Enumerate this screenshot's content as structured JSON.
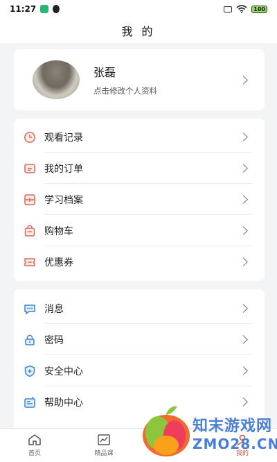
{
  "status": {
    "time": "11:27",
    "battery": "100"
  },
  "header": {
    "title": "我 的"
  },
  "profile": {
    "name": "张磊",
    "subtitle": "点击修改个人资料"
  },
  "menu_group_1": [
    {
      "label": "观看记录",
      "icon": "clock-icon"
    },
    {
      "label": "我的订单",
      "icon": "order-icon"
    },
    {
      "label": "学习档案",
      "icon": "archive-icon"
    },
    {
      "label": "购物车",
      "icon": "cart-icon"
    },
    {
      "label": "优惠券",
      "icon": "coupon-icon"
    }
  ],
  "menu_group_2": [
    {
      "label": "消息",
      "icon": "message-icon"
    },
    {
      "label": "密码",
      "icon": "lock-icon"
    },
    {
      "label": "安全中心",
      "icon": "shield-icon"
    },
    {
      "label": "帮助中心",
      "icon": "help-icon"
    }
  ],
  "tabbar": [
    {
      "label": "首页",
      "icon": "home-icon"
    },
    {
      "label": "精品课",
      "icon": "chart-icon"
    },
    {
      "label": "",
      "icon": "hidden-tab"
    },
    {
      "label": "我的",
      "icon": "user-icon",
      "active": true
    }
  ],
  "watermark": {
    "text": "知末游戏网",
    "domain": "ZMO28.CN"
  },
  "colors": {
    "accent": "#e04b3a",
    "icon_stroke": "#d96b5c",
    "icon_blue": "#3f84d6"
  }
}
